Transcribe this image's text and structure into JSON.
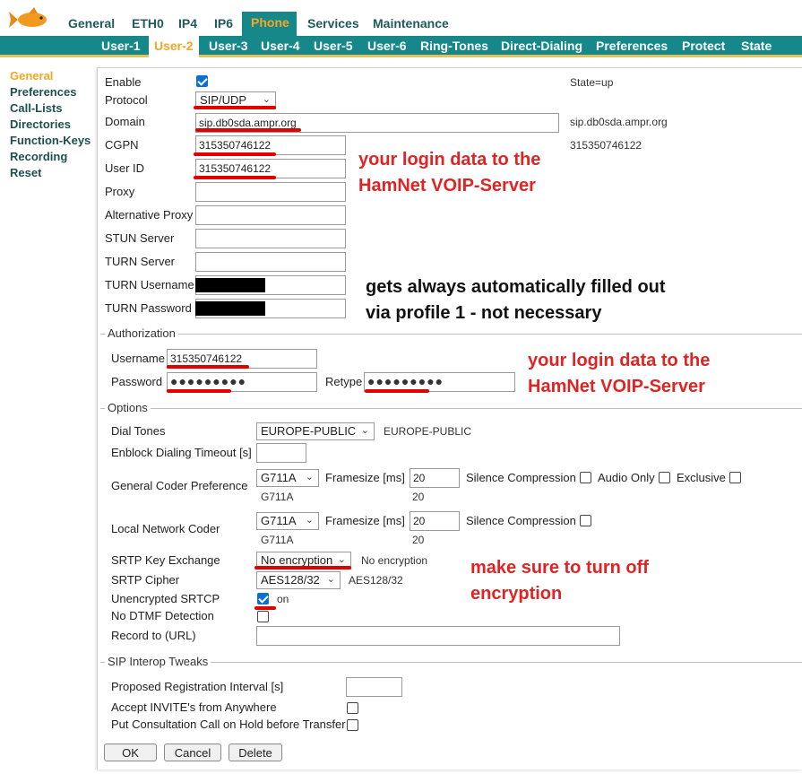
{
  "top_nav": [
    "General",
    "ETH0",
    "IP4",
    "IP6",
    "Phone",
    "Services",
    "Maintenance"
  ],
  "top_active": "Phone",
  "sub_nav": [
    "User-1",
    "User-2",
    "User-3",
    "User-4",
    "User-5",
    "User-6",
    "Ring-Tones",
    "Direct-Dialing",
    "Preferences",
    "Protect",
    "State"
  ],
  "sub_active": "User-2",
  "sidebar": [
    "General",
    "Preferences",
    "Call-Lists",
    "Directories",
    "Function-Keys",
    "Recording",
    "Reset"
  ],
  "sidebar_active": "General",
  "general": {
    "enable_label": "Enable",
    "state_text": "State=up",
    "protocol_label": "Protocol",
    "protocol_value": "SIP/UDP",
    "domain_label": "Domain",
    "domain_value": "sip.db0sda.ampr.org",
    "domain_status": "sip.db0sda.ampr.org",
    "cgpn_label": "CGPN",
    "cgpn_value": "315350746122",
    "cgpn_status": "315350746122",
    "userid_label": "User ID",
    "userid_value": "315350746122",
    "proxy_label": "Proxy",
    "alt_proxy_label": "Alternative Proxy",
    "stun_label": "STUN Server",
    "turn_label": "TURN Server",
    "turn_user_label": "TURN Username",
    "turn_pass_label": "TURN Password"
  },
  "authorization": {
    "legend": "Authorization",
    "username_label": "Username",
    "username_value": "315350746122",
    "password_label": "Password",
    "password_value": "●●●●●●●●●",
    "retype_label": "Retype",
    "retype_value": "●●●●●●●●●"
  },
  "options": {
    "legend": "Options",
    "dial_tones_label": "Dial Tones",
    "dial_tones_value": "EUROPE-PUBLIC",
    "dial_tones_status": "EUROPE-PUBLIC",
    "enblock_label": "Enblock Dialing Timeout [s]",
    "gen_coder_label": "General Coder Preference",
    "gen_coder_value": "G711A",
    "gen_coder_status": "G711A",
    "framesize_label": "Framesize [ms]",
    "gen_framesize_value": "20",
    "gen_framesize_status": "20",
    "silence_label": "Silence Compression",
    "audio_only_label": "Audio Only",
    "exclusive_label": "Exclusive",
    "local_coder_label": "Local Network Coder",
    "local_coder_value": "G711A",
    "local_coder_status": "G711A",
    "local_framesize_value": "20",
    "local_framesize_status": "20",
    "srtp_kx_label": "SRTP Key Exchange",
    "srtp_kx_value": "No encryption",
    "srtp_kx_status": "No encryption",
    "srtp_cipher_label": "SRTP Cipher",
    "srtp_cipher_value": "AES128/32",
    "srtp_cipher_status": "AES128/32",
    "unenc_srtcp_label": "Unencrypted SRTCP",
    "unenc_srtcp_status": "on",
    "no_dtmf_label": "No DTMF Detection",
    "record_label": "Record to (URL)"
  },
  "interop": {
    "legend": "SIP Interop Tweaks",
    "reg_interval_label": "Proposed Registration Interval [s]",
    "accept_invite_label": "Accept INVITE's from Anywhere",
    "put_hold_label": "Put Consultation Call on Hold before Transfer"
  },
  "buttons": {
    "ok": "OK",
    "cancel": "Cancel",
    "delete": "Delete"
  },
  "annotations": {
    "login1_line1": "your login data to the",
    "login1_line2": "HamNet VOIP-Server",
    "auto_line1": "gets always automatically filled out",
    "auto_line2": "via profile 1 - not necessary",
    "login2_line1": "your login data to the",
    "login2_line2": "HamNet VOIP-Server",
    "enc_line1": "make sure to turn off",
    "enc_line2": "encryption"
  },
  "colors": {
    "teal": "#17888a",
    "orange": "#f5a623",
    "annotation_red": "#e02424"
  }
}
